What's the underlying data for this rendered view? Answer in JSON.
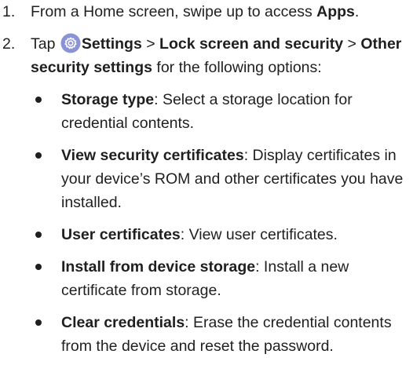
{
  "steps": [
    {
      "number": "1.",
      "text": "From a Home screen, swipe up to access ",
      "bold": "Apps",
      "end": "."
    },
    {
      "number": "2.",
      "prefix": "Tap ",
      "icon": "settings-gear-icon",
      "path1": "Settings",
      "sep1": " > ",
      "path2": "Lock screen and security",
      "sep2": " > ",
      "path3": "Other security settings",
      "suffix": " for the following options:"
    }
  ],
  "options": [
    {
      "term": "Storage type",
      "desc": ": Select a storage location for credential contents."
    },
    {
      "term": "View security certificates",
      "desc": ": Display certificates in your device’s ROM and other certificates you have installed."
    },
    {
      "term": "User certificates",
      "desc": ": View user certificates."
    },
    {
      "term": "Install from device storage",
      "desc": ": Install a new certificate from storage."
    },
    {
      "term": "Clear credentials",
      "desc": ": Erase the credential contents from the device and reset the password."
    }
  ],
  "colors": {
    "text": "#1f1f1f",
    "icon_bg": "#8a93d6",
    "icon_fg": "#ffffff"
  }
}
